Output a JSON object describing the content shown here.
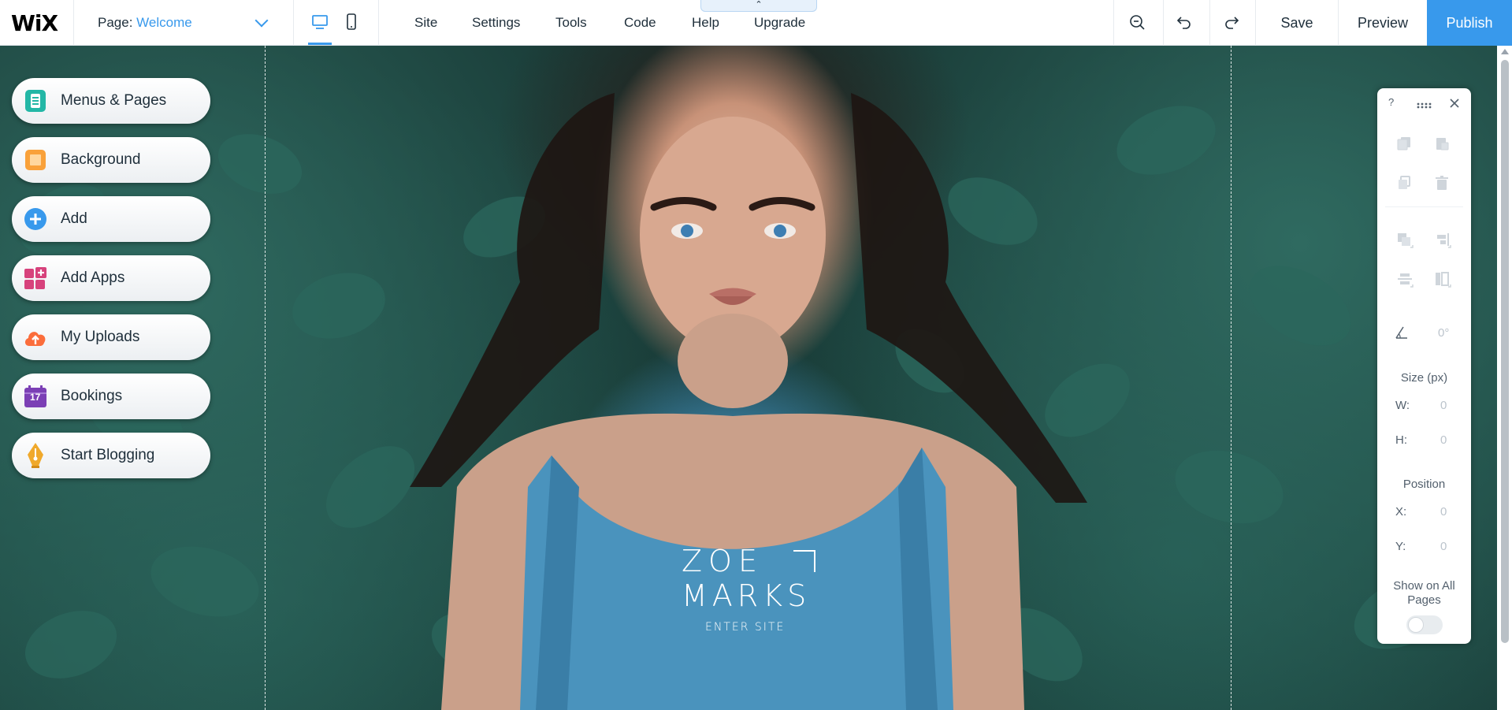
{
  "app": {
    "logo": "WiX"
  },
  "topbar": {
    "page_prefix": "Page:",
    "page_name": "Welcome",
    "menu": [
      "Site",
      "Settings",
      "Tools",
      "Code",
      "Help",
      "Upgrade"
    ],
    "help_tab_glyph": "⌃",
    "save_label": "Save",
    "preview_label": "Preview",
    "publish_label": "Publish",
    "icons": [
      "desktop-icon",
      "mobile-icon",
      "zoom-out-icon",
      "undo-icon",
      "redo-icon"
    ]
  },
  "left_panel": {
    "items": [
      {
        "label": "Menus & Pages",
        "icon": "menus-pages-icon",
        "color": "#23b7a6"
      },
      {
        "label": "Background",
        "icon": "background-icon",
        "color": "#f9a13a"
      },
      {
        "label": "Add",
        "icon": "add-icon",
        "color": "#3899ec"
      },
      {
        "label": "Add Apps",
        "icon": "add-apps-icon",
        "color": "#d7427c"
      },
      {
        "label": "My Uploads",
        "icon": "upload-icon",
        "color": "#fb6d3b"
      },
      {
        "label": "Bookings",
        "icon": "bookings-icon",
        "color": "#7b3fb5",
        "badge": "17"
      },
      {
        "label": "Start Blogging",
        "icon": "blog-pen-icon",
        "color": "#f0a92c"
      }
    ]
  },
  "site": {
    "title_line1": "ZOE",
    "title_line2": "MARKS",
    "enter_label": "ENTER SITE"
  },
  "right_panel": {
    "help": "?",
    "rotation": "0°",
    "size_label": "Size (px)",
    "w_key": "W:",
    "w_value": "0",
    "h_key": "H:",
    "h_value": "0",
    "position_label": "Position",
    "x_key": "X:",
    "x_value": "0",
    "y_key": "Y:",
    "y_value": "0",
    "show_all_pages": "Show on All Pages",
    "show_all_pages_on": false
  },
  "colors": {
    "accent": "#3899ec",
    "text": "#20303c",
    "panel_muted": "#9aa3ad"
  }
}
